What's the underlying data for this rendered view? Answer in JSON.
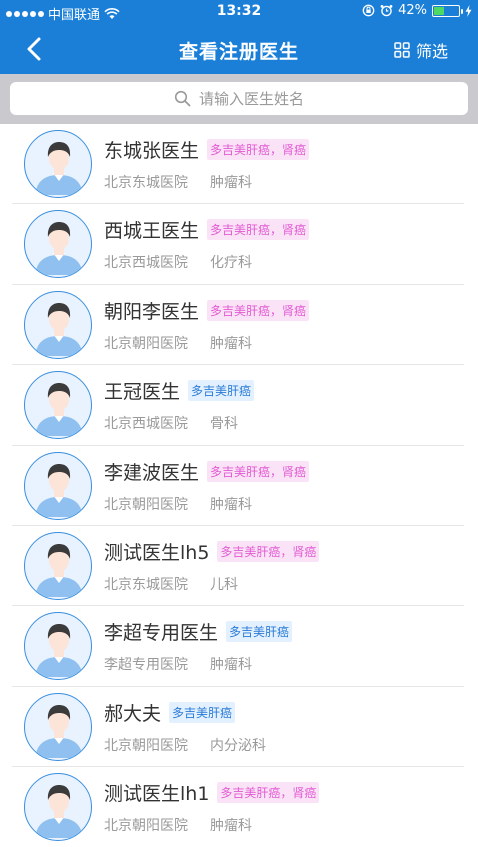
{
  "status_bar": {
    "carrier": "中国联通",
    "time": "13:32",
    "battery_percent": "42%",
    "battery_level": 0.42
  },
  "nav": {
    "title": "查看注册医生",
    "filter_label": "筛选"
  },
  "search": {
    "placeholder": "请输入医生姓名"
  },
  "doctors": [
    {
      "name": "东城张医生",
      "tag": "多吉美肝癌，肾癌",
      "tag_color": "pink",
      "hospital": "北京东城医院",
      "department": "肿瘤科"
    },
    {
      "name": "西城王医生",
      "tag": "多吉美肝癌，肾癌",
      "tag_color": "pink",
      "hospital": "北京西城医院",
      "department": "化疗科"
    },
    {
      "name": "朝阳李医生",
      "tag": "多吉美肝癌，肾癌",
      "tag_color": "pink",
      "hospital": "北京朝阳医院",
      "department": "肿瘤科"
    },
    {
      "name": "王冠医生",
      "tag": "多吉美肝癌",
      "tag_color": "blue",
      "hospital": "北京西城医院",
      "department": "骨科"
    },
    {
      "name": "李建波医生",
      "tag": "多吉美肝癌，肾癌",
      "tag_color": "pink",
      "hospital": "北京朝阳医院",
      "department": "肿瘤科"
    },
    {
      "name": "测试医生lh5",
      "tag": "多吉美肝癌，肾癌",
      "tag_color": "pink",
      "hospital": "北京东城医院",
      "department": "儿科"
    },
    {
      "name": "李超专用医生",
      "tag": "多吉美肝癌",
      "tag_color": "blue",
      "hospital": "李超专用医院",
      "department": "肿瘤科"
    },
    {
      "name": "郝大夫",
      "tag": "多吉美肝癌",
      "tag_color": "blue",
      "hospital": "北京朝阳医院",
      "department": "内分泌科"
    },
    {
      "name": "测试医生lh1",
      "tag": "多吉美肝癌，肾癌",
      "tag_color": "pink",
      "hospital": "北京朝阳医院",
      "department": "肿瘤科"
    }
  ],
  "colors": {
    "header": "#1b7fd8",
    "tag_pink": "#e25bd3",
    "tag_blue": "#2a7bd6"
  }
}
